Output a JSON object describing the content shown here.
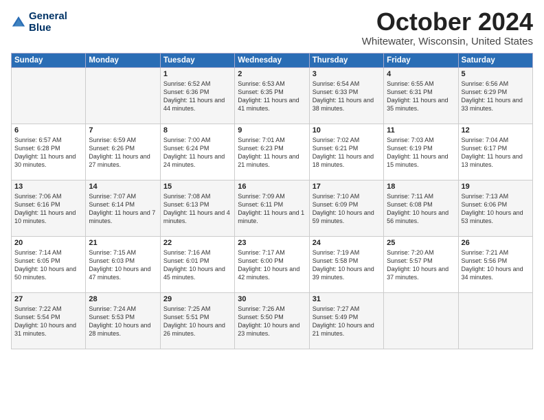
{
  "header": {
    "logo_line1": "General",
    "logo_line2": "Blue",
    "month": "October 2024",
    "location": "Whitewater, Wisconsin, United States"
  },
  "weekdays": [
    "Sunday",
    "Monday",
    "Tuesday",
    "Wednesday",
    "Thursday",
    "Friday",
    "Saturday"
  ],
  "weeks": [
    [
      {
        "day": "",
        "content": ""
      },
      {
        "day": "",
        "content": ""
      },
      {
        "day": "1",
        "content": "Sunrise: 6:52 AM\nSunset: 6:36 PM\nDaylight: 11 hours\nand 44 minutes."
      },
      {
        "day": "2",
        "content": "Sunrise: 6:53 AM\nSunset: 6:35 PM\nDaylight: 11 hours\nand 41 minutes."
      },
      {
        "day": "3",
        "content": "Sunrise: 6:54 AM\nSunset: 6:33 PM\nDaylight: 11 hours\nand 38 minutes."
      },
      {
        "day": "4",
        "content": "Sunrise: 6:55 AM\nSunset: 6:31 PM\nDaylight: 11 hours\nand 35 minutes."
      },
      {
        "day": "5",
        "content": "Sunrise: 6:56 AM\nSunset: 6:29 PM\nDaylight: 11 hours\nand 33 minutes."
      }
    ],
    [
      {
        "day": "6",
        "content": "Sunrise: 6:57 AM\nSunset: 6:28 PM\nDaylight: 11 hours\nand 30 minutes."
      },
      {
        "day": "7",
        "content": "Sunrise: 6:59 AM\nSunset: 6:26 PM\nDaylight: 11 hours\nand 27 minutes."
      },
      {
        "day": "8",
        "content": "Sunrise: 7:00 AM\nSunset: 6:24 PM\nDaylight: 11 hours\nand 24 minutes."
      },
      {
        "day": "9",
        "content": "Sunrise: 7:01 AM\nSunset: 6:23 PM\nDaylight: 11 hours\nand 21 minutes."
      },
      {
        "day": "10",
        "content": "Sunrise: 7:02 AM\nSunset: 6:21 PM\nDaylight: 11 hours\nand 18 minutes."
      },
      {
        "day": "11",
        "content": "Sunrise: 7:03 AM\nSunset: 6:19 PM\nDaylight: 11 hours\nand 15 minutes."
      },
      {
        "day": "12",
        "content": "Sunrise: 7:04 AM\nSunset: 6:17 PM\nDaylight: 11 hours\nand 13 minutes."
      }
    ],
    [
      {
        "day": "13",
        "content": "Sunrise: 7:06 AM\nSunset: 6:16 PM\nDaylight: 11 hours\nand 10 minutes."
      },
      {
        "day": "14",
        "content": "Sunrise: 7:07 AM\nSunset: 6:14 PM\nDaylight: 11 hours\nand 7 minutes."
      },
      {
        "day": "15",
        "content": "Sunrise: 7:08 AM\nSunset: 6:13 PM\nDaylight: 11 hours\nand 4 minutes."
      },
      {
        "day": "16",
        "content": "Sunrise: 7:09 AM\nSunset: 6:11 PM\nDaylight: 11 hours\nand 1 minute."
      },
      {
        "day": "17",
        "content": "Sunrise: 7:10 AM\nSunset: 6:09 PM\nDaylight: 10 hours\nand 59 minutes."
      },
      {
        "day": "18",
        "content": "Sunrise: 7:11 AM\nSunset: 6:08 PM\nDaylight: 10 hours\nand 56 minutes."
      },
      {
        "day": "19",
        "content": "Sunrise: 7:13 AM\nSunset: 6:06 PM\nDaylight: 10 hours\nand 53 minutes."
      }
    ],
    [
      {
        "day": "20",
        "content": "Sunrise: 7:14 AM\nSunset: 6:05 PM\nDaylight: 10 hours\nand 50 minutes."
      },
      {
        "day": "21",
        "content": "Sunrise: 7:15 AM\nSunset: 6:03 PM\nDaylight: 10 hours\nand 47 minutes."
      },
      {
        "day": "22",
        "content": "Sunrise: 7:16 AM\nSunset: 6:01 PM\nDaylight: 10 hours\nand 45 minutes."
      },
      {
        "day": "23",
        "content": "Sunrise: 7:17 AM\nSunset: 6:00 PM\nDaylight: 10 hours\nand 42 minutes."
      },
      {
        "day": "24",
        "content": "Sunrise: 7:19 AM\nSunset: 5:58 PM\nDaylight: 10 hours\nand 39 minutes."
      },
      {
        "day": "25",
        "content": "Sunrise: 7:20 AM\nSunset: 5:57 PM\nDaylight: 10 hours\nand 37 minutes."
      },
      {
        "day": "26",
        "content": "Sunrise: 7:21 AM\nSunset: 5:56 PM\nDaylight: 10 hours\nand 34 minutes."
      }
    ],
    [
      {
        "day": "27",
        "content": "Sunrise: 7:22 AM\nSunset: 5:54 PM\nDaylight: 10 hours\nand 31 minutes."
      },
      {
        "day": "28",
        "content": "Sunrise: 7:24 AM\nSunset: 5:53 PM\nDaylight: 10 hours\nand 28 minutes."
      },
      {
        "day": "29",
        "content": "Sunrise: 7:25 AM\nSunset: 5:51 PM\nDaylight: 10 hours\nand 26 minutes."
      },
      {
        "day": "30",
        "content": "Sunrise: 7:26 AM\nSunset: 5:50 PM\nDaylight: 10 hours\nand 23 minutes."
      },
      {
        "day": "31",
        "content": "Sunrise: 7:27 AM\nSunset: 5:49 PM\nDaylight: 10 hours\nand 21 minutes."
      },
      {
        "day": "",
        "content": ""
      },
      {
        "day": "",
        "content": ""
      }
    ]
  ]
}
